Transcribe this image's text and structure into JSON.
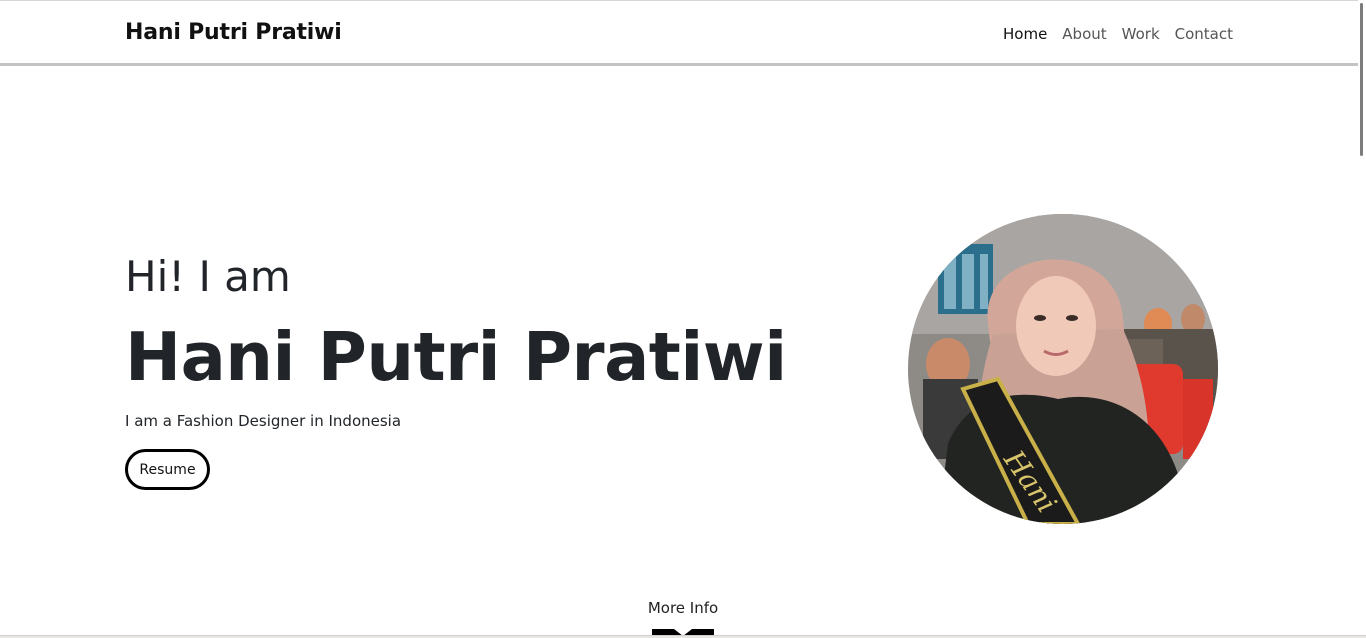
{
  "navbar": {
    "brand": "Hani Putri Pratiwi",
    "links": [
      {
        "label": "Home",
        "active": true
      },
      {
        "label": "About",
        "active": false
      },
      {
        "label": "Work",
        "active": false
      },
      {
        "label": "Contact",
        "active": false
      }
    ]
  },
  "hero": {
    "greeting": "Hi! I am",
    "name": "Hani Putri Pratiwi",
    "tagline": "I am a Fashion Designer in Indonesia",
    "resume_label": "Resume",
    "sash_text": "Hani"
  },
  "more_info": {
    "label": "More Info",
    "icon": "chevron-down-icon"
  },
  "colors": {
    "text": "#212529",
    "accent": "#000000",
    "navbar_border": "#c4c4c4"
  }
}
